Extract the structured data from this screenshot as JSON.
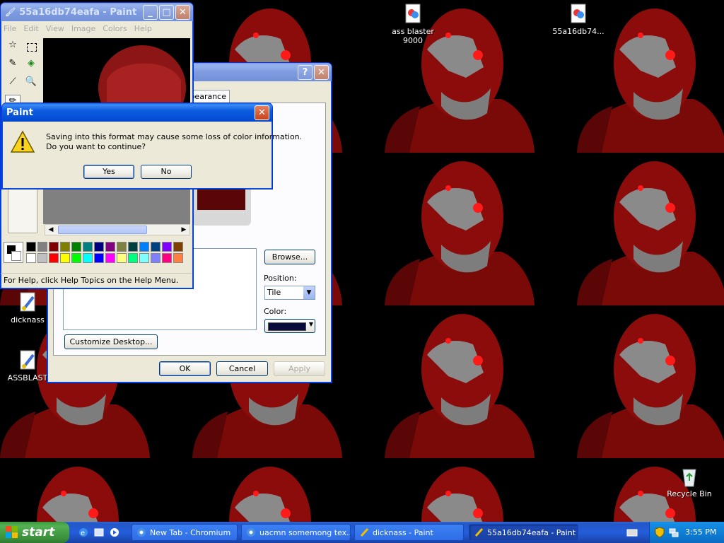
{
  "desktop": {
    "icons": [
      {
        "label": "ass blaster 9000"
      },
      {
        "label": "55a16db74..."
      },
      {
        "label": "dicknass"
      },
      {
        "label": "ASSBLAST"
      },
      {
        "label": "Recycle Bin"
      }
    ]
  },
  "paint_window": {
    "title": "55a16db74eafa - Paint",
    "menu": [
      "File",
      "Edit",
      "View",
      "Image",
      "Colors",
      "Help"
    ],
    "status": "For Help, click Help Topics on the Help Menu.",
    "palette_top": [
      "#000000",
      "#808080",
      "#800000",
      "#808000",
      "#008000",
      "#008080",
      "#000080",
      "#800080",
      "#808040",
      "#004040",
      "#0080ff",
      "#004080",
      "#8000ff",
      "#804000"
    ],
    "palette_bottom": [
      "#ffffff",
      "#c0c0c0",
      "#ff0000",
      "#ffff00",
      "#00ff00",
      "#00ffff",
      "#0000ff",
      "#ff00ff",
      "#ffff80",
      "#00ff80",
      "#80ffff",
      "#8080ff",
      "#ff0080",
      "#ff8040"
    ]
  },
  "display_props": {
    "tab_label": "pearance",
    "browse_label": "Browse...",
    "position_label": "Position:",
    "position_value": "Tile",
    "color_label": "Color:",
    "color_value": "#0a0a3c",
    "customize_label": "Customize Desktop...",
    "ok_label": "OK",
    "cancel_label": "Cancel",
    "apply_label": "Apply"
  },
  "dialog": {
    "title": "Paint",
    "message_line1": "Saving into this format may cause some loss of color information.",
    "message_line2": "Do you want to continue?",
    "yes_label": "Yes",
    "no_label": "No"
  },
  "taskbar": {
    "start_label": "start",
    "tasks": [
      {
        "label": "New Tab - Chromium",
        "active": false
      },
      {
        "label": "uacmn somemong tex...",
        "active": false
      },
      {
        "label": "dicknass - Paint",
        "active": false
      },
      {
        "label": "55a16db74eafa - Paint",
        "active": true
      }
    ],
    "clock": "3:55 PM"
  }
}
